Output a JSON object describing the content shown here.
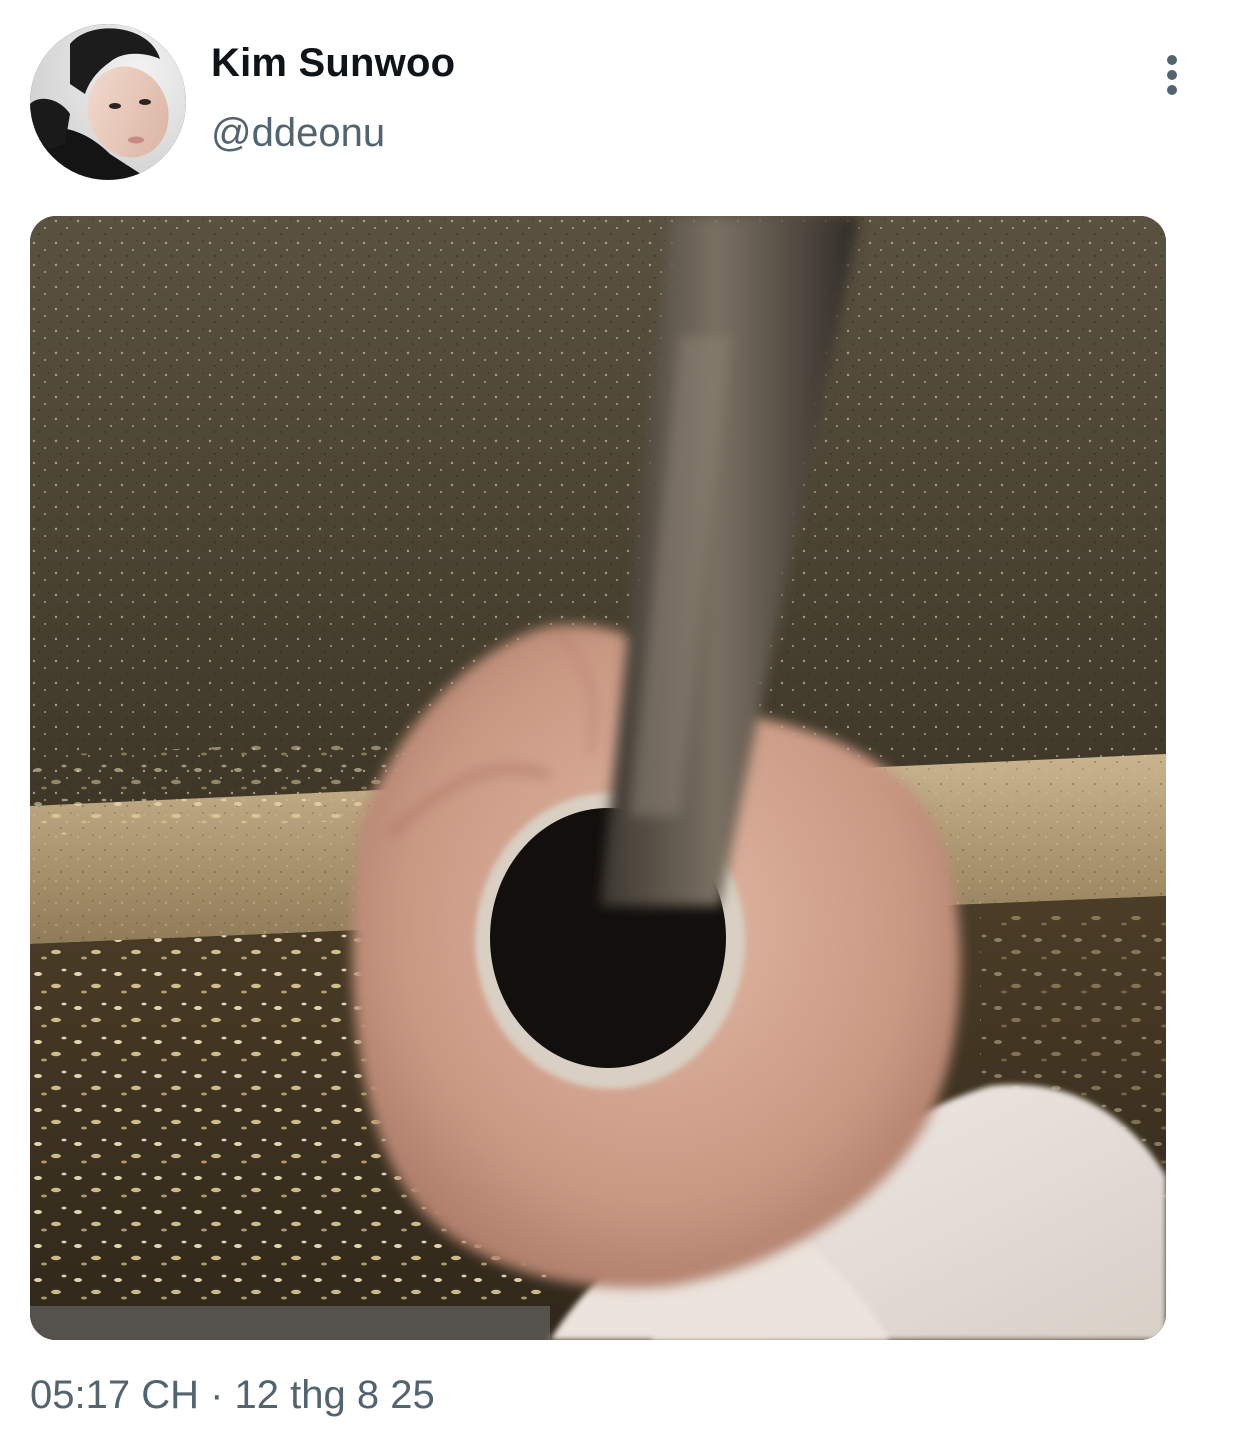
{
  "tweet": {
    "author": {
      "display_name": "Kim Sunwoo",
      "handle": "@ddeonu",
      "avatar_icon": "profile-photo"
    },
    "more_icon": "more-options-vertical-icon",
    "media": {
      "kind": "photo"
    },
    "timestamp": "05:17 CH · 12 thg 8 25"
  }
}
